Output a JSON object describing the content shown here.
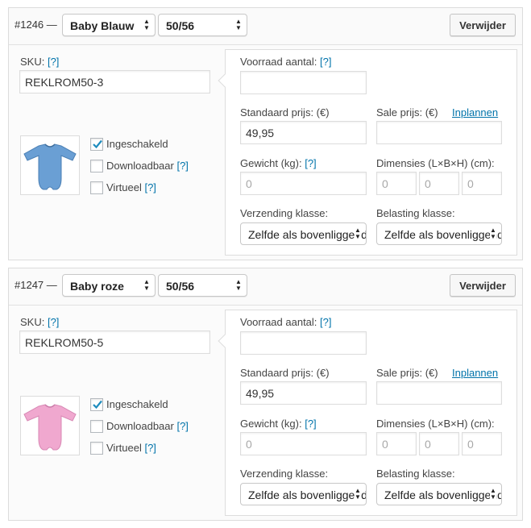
{
  "variations": [
    {
      "id_label": "#1246 —",
      "color_value": "Baby Blauw",
      "size_value": "50/56",
      "remove_label": "Verwijder",
      "sku_label": "SKU:",
      "sku_help": "[?]",
      "sku_value": "REKLROM50-3",
      "thumb_color": "#6a9fd4",
      "checkboxes": [
        {
          "label": "Ingeschakeld",
          "help": "",
          "checked": true
        },
        {
          "label": "Downloadbaar",
          "help": "[?]",
          "checked": false
        },
        {
          "label": "Virtueel",
          "help": "[?]",
          "checked": false
        }
      ],
      "stock_label": "Voorraad aantal:",
      "stock_help": "[?]",
      "stock_value": "",
      "regular_price_label": "Standaard prijs: (€)",
      "regular_price_value": "49,95",
      "sale_price_label": "Sale prijs: (€)",
      "schedule_link": "Inplannen",
      "sale_price_value": "",
      "weight_label": "Gewicht (kg):",
      "weight_help": "[?]",
      "weight_placeholder": "0",
      "dimensions_label": "Dimensies (L×B×H) (cm):",
      "dim_placeholders": [
        "0",
        "0",
        "0"
      ],
      "shipping_label": "Verzending klasse:",
      "shipping_value": "Zelfde als bovenliggende",
      "tax_label": "Belasting klasse:",
      "tax_value": "Zelfde als bovenliggende"
    },
    {
      "id_label": "#1247 —",
      "color_value": "Baby roze",
      "size_value": "50/56",
      "remove_label": "Verwijder",
      "sku_label": "SKU:",
      "sku_help": "[?]",
      "sku_value": "REKLROM50-5",
      "thumb_color": "#f0a8cf",
      "checkboxes": [
        {
          "label": "Ingeschakeld",
          "help": "",
          "checked": true
        },
        {
          "label": "Downloadbaar",
          "help": "[?]",
          "checked": false
        },
        {
          "label": "Virtueel",
          "help": "[?]",
          "checked": false
        }
      ],
      "stock_label": "Voorraad aantal:",
      "stock_help": "[?]",
      "stock_value": "",
      "regular_price_label": "Standaard prijs: (€)",
      "regular_price_value": "49,95",
      "sale_price_label": "Sale prijs: (€)",
      "schedule_link": "Inplannen",
      "sale_price_value": "",
      "weight_label": "Gewicht (kg):",
      "weight_help": "[?]",
      "weight_placeholder": "0",
      "dimensions_label": "Dimensies (L×B×H) (cm):",
      "dim_placeholders": [
        "0",
        "0",
        "0"
      ],
      "shipping_label": "Verzending klasse:",
      "shipping_value": "Zelfde als bovenliggende",
      "tax_label": "Belasting klasse:",
      "tax_value": "Zelfde als bovenliggende"
    }
  ]
}
